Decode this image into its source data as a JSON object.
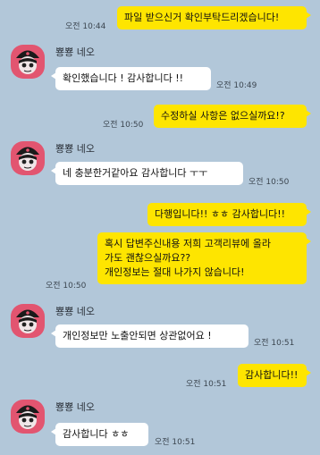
{
  "messages": [
    {
      "from": "me",
      "text": "파일 받으신거 확인부탁드리겠습니다!",
      "time": "오전 10:44"
    },
    {
      "from": "them",
      "sender": "뿅뿅 네오",
      "text": "확인했습니다 ! 감사합니다 !!",
      "time": "오전 10:49"
    },
    {
      "from": "me",
      "text": "수정하실 사항은 없으실까요!?",
      "time": "오전 10:50"
    },
    {
      "from": "them",
      "sender": "뿅뿅 네오",
      "text": "네 충분한거같아요 감사합니다 ㅜㅜ",
      "time": "오전 10:50"
    },
    {
      "from": "me",
      "text": "다행입니다!! ㅎㅎ 감사합니다!!",
      "time": ""
    },
    {
      "from": "me",
      "lines": [
        "혹시 답변주신내용 저희 고객리뷰에 올라",
        "가도 괜찮으실까요??",
        "개인정보는 절대 나가지 않습니다!"
      ],
      "time": "오전 10:50"
    },
    {
      "from": "them",
      "sender": "뿅뿅 네오",
      "text": "개인정보만 노출안되면 상관없어요 !",
      "time": "오전 10:51"
    },
    {
      "from": "me",
      "text": "감사합니다!!",
      "time": "오전 10:51"
    },
    {
      "from": "them",
      "sender": "뿅뿅 네오",
      "text": "감사합니다 ㅎㅎ",
      "time": "오전 10:51"
    }
  ],
  "colors": {
    "background": "#b2c7d9",
    "my_bubble": "#fee500",
    "their_bubble": "#ffffff",
    "avatar": "#e25570"
  }
}
